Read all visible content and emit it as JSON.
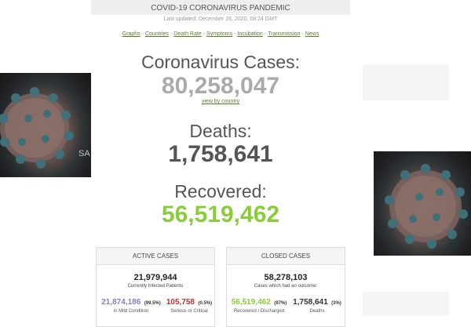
{
  "header": {
    "title": "COVID-19 CORONAVIRUS PANDEMIC",
    "updated": "Last updated: December 26, 2020, 08:24 GMT"
  },
  "nav": {
    "links": [
      "Graphs",
      "Countries",
      "Death Rate",
      "Symptoms",
      "Incubation",
      "Transmission",
      "News"
    ],
    "separator": "-"
  },
  "cases": {
    "label": "Coronavirus Cases:",
    "value": "80,258,047",
    "link": "view by country"
  },
  "deaths": {
    "label": "Deaths:",
    "value": "1,758,641"
  },
  "recovered": {
    "label": "Recovered:",
    "value": "56,519,462"
  },
  "active": {
    "heading": "ACTIVE CASES",
    "total": "21,979,944",
    "subtitle": "Currently Infected Patients",
    "mild": {
      "value": "21,874,186",
      "pct": "99.5",
      "label": "in Mild Condition"
    },
    "serious": {
      "value": "105,758",
      "pct": "0.5",
      "label": "Serious or Critical"
    }
  },
  "closed": {
    "heading": "CLOSED CASES",
    "total": "58,278,103",
    "subtitle": "Cases which had an outcome:",
    "recovered": {
      "value": "56,519,462",
      "pct": "97",
      "label": "Recovered / Discharged"
    },
    "deaths": {
      "value": "1,758,641",
      "pct": "3",
      "label": "Deaths"
    }
  },
  "images": {
    "left_caption": "SA"
  },
  "colors": {
    "cases": "#aaaaaa",
    "deaths": "#555555",
    "recovered": "#8acd3b",
    "mild": "#8080c0",
    "serious": "#c4302b",
    "closed_recovered": "#8acd3b",
    "link": "#5a7d2a"
  }
}
